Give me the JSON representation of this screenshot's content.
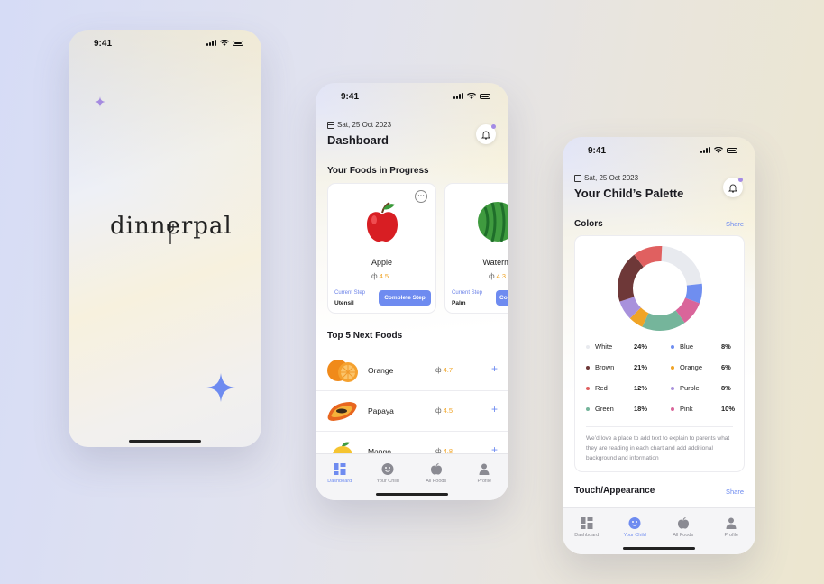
{
  "splash": {
    "time": "9:41",
    "logo": "dinnerpal"
  },
  "dashboard": {
    "time": "9:41",
    "date": "Sat, 25 Oct 2023",
    "title": "Dashboard",
    "in_progress_heading": "Your Foods in Progress",
    "cards": [
      {
        "name": "Apple",
        "rating": "4.5",
        "step_label": "Current Step",
        "step_value": "Utensil",
        "button": "Complete Step"
      },
      {
        "name": "Waterme",
        "rating": "4.3",
        "step_label": "Current Step",
        "step_value": "Palm",
        "button": "Com"
      }
    ],
    "top5_heading": "Top 5 Next Foods",
    "top5": [
      {
        "name": "Orange",
        "rating": "4.7"
      },
      {
        "name": "Papaya",
        "rating": "4.5"
      },
      {
        "name": "Mango",
        "rating": "4.8"
      }
    ],
    "tabs": [
      {
        "label": "Dashboard",
        "icon": "grid-icon",
        "active": true
      },
      {
        "label": "Your Child",
        "icon": "smiley-icon",
        "active": false
      },
      {
        "label": "All Foods",
        "icon": "apple-icon",
        "active": false
      },
      {
        "label": "Profile",
        "icon": "person-icon",
        "active": false
      }
    ]
  },
  "palette": {
    "time": "9:41",
    "date": "Sat, 25 Oct 2023",
    "title": "Your Child’s Palette",
    "colors_heading": "Colors",
    "share_label": "Share",
    "legend": [
      {
        "name": "White",
        "pct": "24%",
        "value": 24,
        "color": "#e8eaef"
      },
      {
        "name": "Blue",
        "pct": "8%",
        "value": 8,
        "color": "#6f8ef0"
      },
      {
        "name": "Brown",
        "pct": "21%",
        "value": 21,
        "color": "#6e3838"
      },
      {
        "name": "Orange",
        "pct": "6%",
        "value": 6,
        "color": "#f0a426"
      },
      {
        "name": "Red",
        "pct": "12%",
        "value": 12,
        "color": "#e06060"
      },
      {
        "name": "Purple",
        "pct": "8%",
        "value": 8,
        "color": "#a891dc"
      },
      {
        "name": "Green",
        "pct": "18%",
        "value": 18,
        "color": "#75b59b"
      },
      {
        "name": "Pink",
        "pct": "10%",
        "value": 10,
        "color": "#d9659a"
      }
    ],
    "note": "We’d love a place to add text to explain to parents what they are reading in each chart and add additional background and information",
    "touch_heading": "Touch/Appearance",
    "touch_share": "Share",
    "tabs": [
      {
        "label": "Dashboard",
        "icon": "grid-icon",
        "active": false
      },
      {
        "label": "Your Child",
        "icon": "smiley-icon",
        "active": true
      },
      {
        "label": "All Foods",
        "icon": "apple-icon",
        "active": false
      },
      {
        "label": "Profile",
        "icon": "person-icon",
        "active": false
      }
    ]
  },
  "chart_data": {
    "type": "pie",
    "categories": [
      "White",
      "Blue",
      "Pink",
      "Green",
      "Orange",
      "Purple",
      "Brown",
      "Red"
    ],
    "values": [
      24,
      8,
      10,
      18,
      6,
      8,
      21,
      12
    ],
    "title": "Colors"
  }
}
